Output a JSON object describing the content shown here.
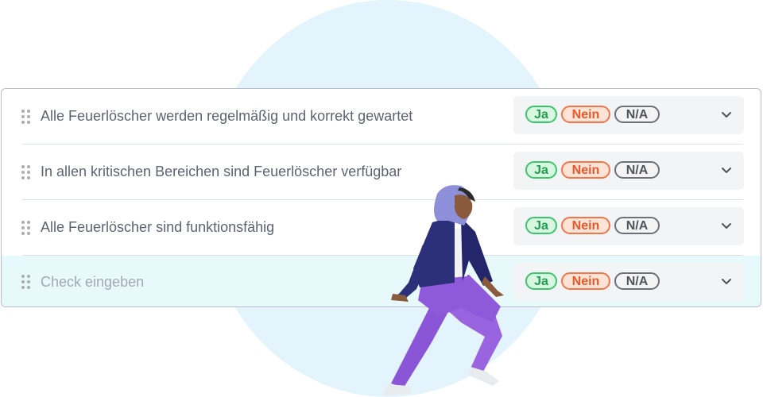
{
  "checklist": {
    "items": [
      {
        "label": "Alle Feuerlöscher werden regelmäßig und korrekt gewartet",
        "yes": "Ja",
        "no": "Nein",
        "na": "N/A"
      },
      {
        "label": "In allen kritischen Bereichen sind Feuerlöscher verfügbar",
        "yes": "Ja",
        "no": "Nein",
        "na": "N/A"
      },
      {
        "label": "Alle Feuerlöscher sind funktionsfähig",
        "yes": "Ja",
        "no": "Nein",
        "na": "N/A"
      },
      {
        "label": "Check eingeben",
        "yes": "Ja",
        "no": "Nein",
        "na": "N/A"
      }
    ]
  },
  "colors": {
    "yes_accent": "#3cc46f",
    "no_accent": "#f3764a",
    "na_accent": "#6b7178",
    "highlight_row": "#e7f9fb",
    "background_circle": "#e3f4fd"
  },
  "icons": [
    "drag-handle-icon",
    "chevron-down-icon"
  ]
}
